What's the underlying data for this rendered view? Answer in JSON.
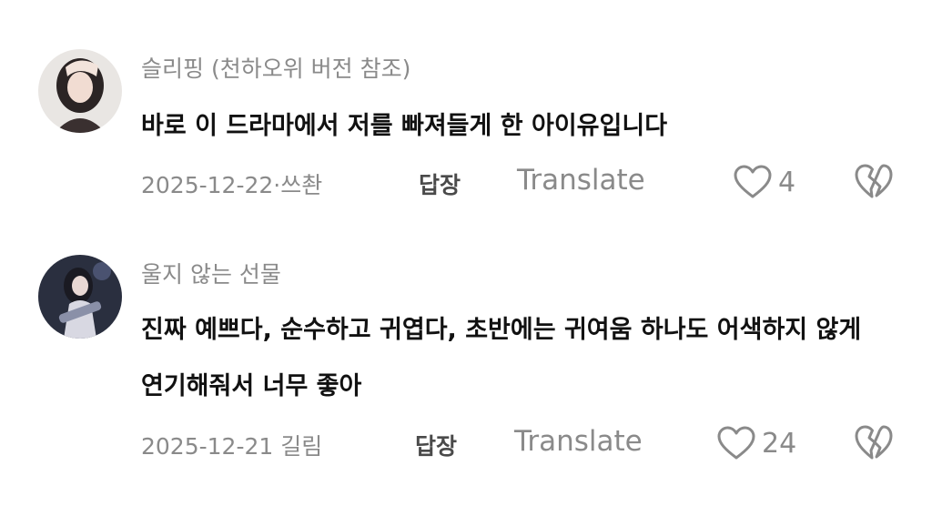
{
  "comments": [
    {
      "username": "슬리핑 (천하오위 버전 참조)",
      "lines": [
        "바로 이 드라마에서 저를 빠져들게 한 아이유입니다"
      ],
      "date_meta": "2025-12-22·쓰촨",
      "reply_label": "답장",
      "translate_label": "Translate",
      "like_count": "4",
      "avatar_icon": "user-avatar-icon"
    },
    {
      "username": "울지 않는 선물",
      "lines": [
        "진짜 예쁘다, 순수하고 귀엽다, 초반에는 귀여움 하나도 어색하지 않게",
        "연기해줘서 너무 좋아"
      ],
      "date_meta": "2025-12-21 길림",
      "reply_label": "답장",
      "translate_label": "Translate",
      "like_count": "24",
      "avatar_icon": "user-avatar-icon"
    }
  ],
  "icons": {
    "like": "heart-outline-icon",
    "dislike": "broken-heart-icon"
  },
  "colors": {
    "muted": "#8a8a8a",
    "text": "#111111",
    "reply": "#4a4a4a"
  }
}
